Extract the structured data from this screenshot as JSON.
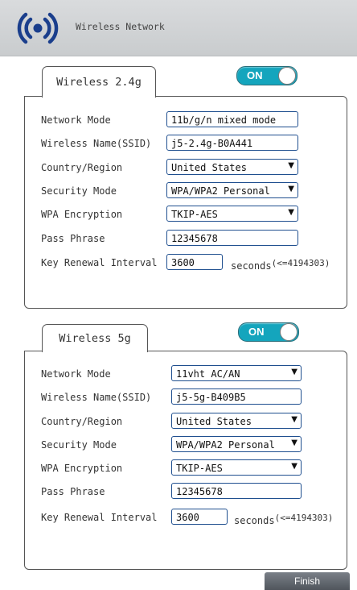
{
  "header": {
    "title": "Wireless Network",
    "icon": "wireless-signal-icon",
    "accent": "#1a3e8c"
  },
  "wifi24": {
    "tab_label": "Wireless 2.4g",
    "toggle_label": "ON",
    "toggle_on": true,
    "fields": {
      "network_mode": {
        "label": "Network Mode",
        "value": "11b/g/n mixed mode"
      },
      "ssid": {
        "label": "Wireless Name(SSID)",
        "value": "j5-2.4g-B0A441"
      },
      "country": {
        "label": "Country/Region",
        "value": "United States"
      },
      "security": {
        "label": "Security Mode",
        "value": "WPA/WPA2 Personal"
      },
      "encryption": {
        "label": "WPA Encryption",
        "value": "TKIP-AES"
      },
      "passphrase": {
        "label": "Pass Phrase",
        "value": "12345678"
      },
      "renewal": {
        "label": "Key Renewal Interval",
        "value": "3600",
        "unit": "seconds",
        "limit": "(<=4194303)"
      }
    }
  },
  "wifi5": {
    "tab_label": "Wireless 5g",
    "toggle_label": "ON",
    "toggle_on": true,
    "fields": {
      "network_mode": {
        "label": "Network Mode",
        "value": "11vht AC/AN"
      },
      "ssid": {
        "label": "Wireless Name(SSID)",
        "value": "j5-5g-B409B5"
      },
      "country": {
        "label": "Country/Region",
        "value": "United States"
      },
      "security": {
        "label": "Security Mode",
        "value": "WPA/WPA2 Personal"
      },
      "encryption": {
        "label": "WPA Encryption",
        "value": "TKIP-AES"
      },
      "passphrase": {
        "label": "Pass Phrase",
        "value": "12345678"
      },
      "renewal": {
        "label": "Key Renewal Interval",
        "value": "3600",
        "unit": "seconds",
        "limit": "(<=4194303)"
      }
    }
  },
  "actions": {
    "finish_label": "Finish"
  },
  "colors": {
    "toggle_on": "#14a5bd",
    "field_border": "#1f4f8f",
    "header_bg": "#d3d5d7",
    "finish_bg": "#5c6168"
  }
}
